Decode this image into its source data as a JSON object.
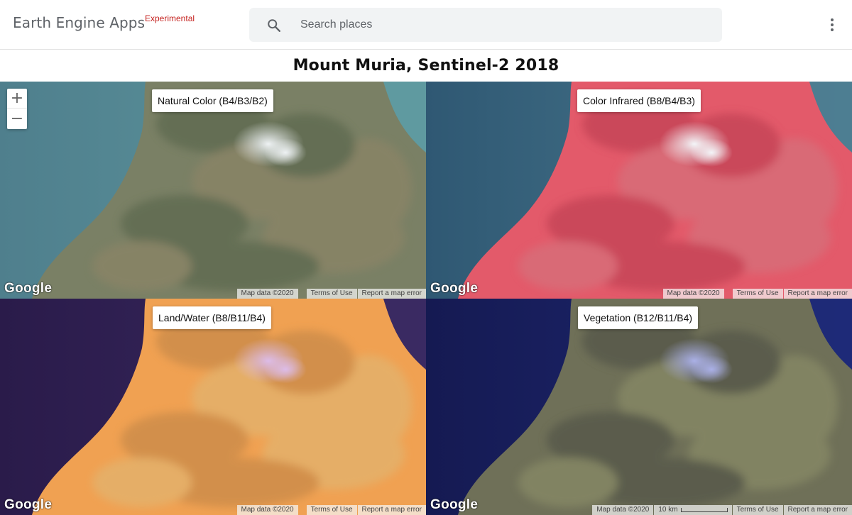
{
  "app": {
    "brand_name": "Earth Engine Apps",
    "brand_tag": "Experimental"
  },
  "search": {
    "placeholder": "Search places",
    "icon": "search-icon"
  },
  "menu": {
    "icon": "more-vert-icon"
  },
  "page_title": "Mount Muria, Sentinel-2 2018",
  "zoom": {
    "in_label": "+",
    "out_label": "−"
  },
  "panels": [
    {
      "label": "Natural Color (B4/B3/B2)",
      "logo": "Google",
      "map_data": "Map data ©2020",
      "terms": "Terms of Use",
      "report": "Report a map error",
      "colors": {
        "sea_deep": "#4f7f8d",
        "sea_shallow": "#5f9aa0",
        "land": "#7a8065",
        "land_alt": "#8b8466",
        "land_dark": "#5d6950",
        "cloud": "#eef2f4"
      }
    },
    {
      "label": "Color Infrared (B8/B4/B3)",
      "logo": "Google",
      "map_data": "Map data ©2020",
      "terms": "Terms of Use",
      "report": "Report a map error",
      "colors": {
        "sea_deep": "#2f5873",
        "sea_shallow": "#4d7e92",
        "land": "#e35a6a",
        "land_alt": "#d6707a",
        "land_dark": "#c24255",
        "cloud": "#f3f5f8"
      }
    },
    {
      "label": "Land/Water (B8/B11/B4)",
      "logo": "Google",
      "map_data": "Map data ©2020",
      "terms": "Terms of Use",
      "report": "Report a map error",
      "colors": {
        "sea_deep": "#2a1b4a",
        "sea_shallow": "#3b2a63",
        "land": "#f0a152",
        "land_alt": "#e2b36e",
        "land_dark": "#c98a4a",
        "cloud": "#dcbce8"
      }
    },
    {
      "label": "Vegetation (B12/B11/B4)",
      "logo": "Google",
      "map_data": "Map data ©2020",
      "scale": "10 km",
      "terms": "Terms of Use",
      "report": "Report a map error",
      "colors": {
        "sea_deep": "#151a52",
        "sea_shallow": "#1f2a78",
        "land": "#6f7058",
        "land_alt": "#888a66",
        "land_dark": "#55574a",
        "cloud": "#aab0e6"
      }
    }
  ]
}
